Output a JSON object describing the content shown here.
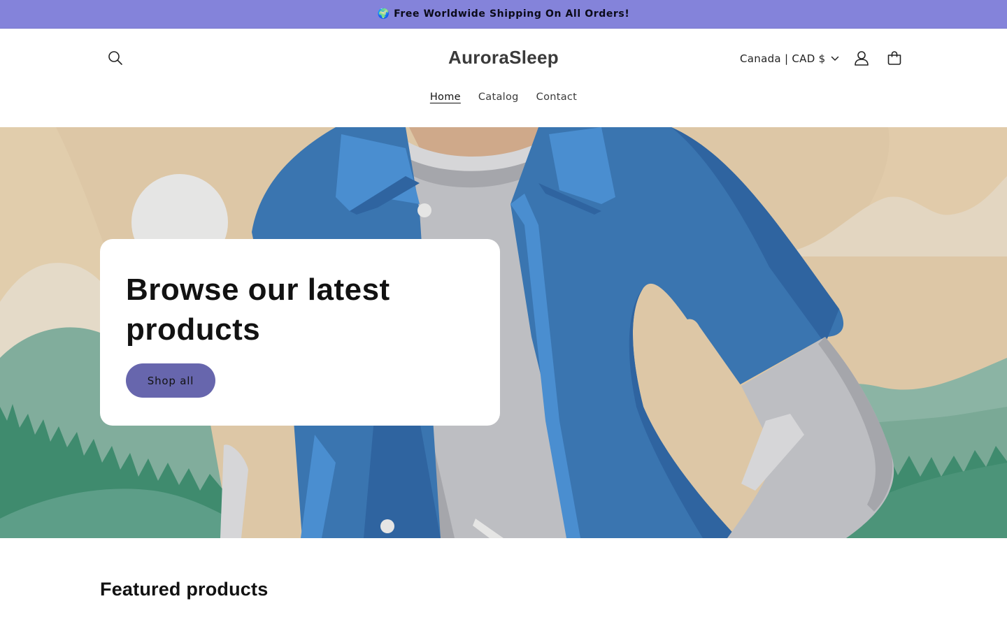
{
  "announcement": {
    "text": "🌍 Free Worldwide Shipping On All Orders!"
  },
  "header": {
    "logo": "AuroraSleep",
    "locale_label": "Canada | CAD $",
    "icons": {
      "search": "search-icon",
      "account": "user-icon",
      "cart": "bag-icon",
      "locale_chevron": "chevron-down-icon"
    }
  },
  "nav": {
    "items": [
      {
        "label": "Home",
        "active": true
      },
      {
        "label": "Catalog",
        "active": false
      },
      {
        "label": "Contact",
        "active": false
      }
    ]
  },
  "hero": {
    "title": "Browse our latest products",
    "button_label": "Shop all",
    "colors": {
      "accent": "#6766ad",
      "announcement_bg": "#8483da"
    }
  },
  "featured": {
    "title": "Featured products"
  }
}
